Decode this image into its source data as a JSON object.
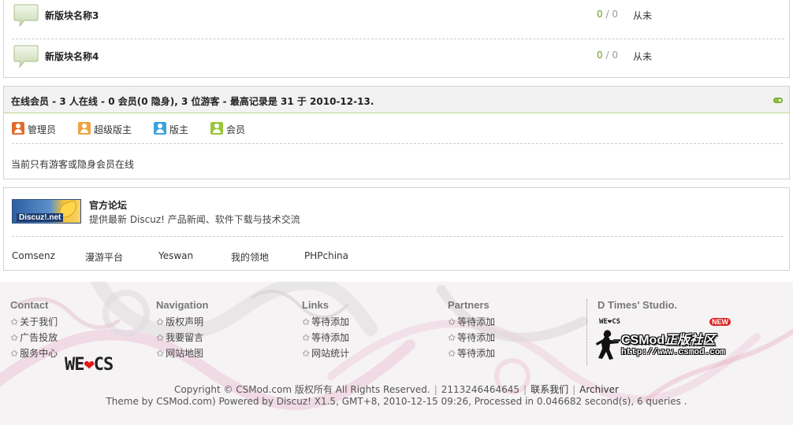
{
  "forums": [
    {
      "name": "新版块名称3",
      "threads": "0",
      "posts": "0",
      "count_sep": " / ",
      "last_post": "从未"
    },
    {
      "name": "新版块名称4",
      "threads": "0",
      "posts": "0",
      "count_sep": " / ",
      "last_post": "从未"
    }
  ],
  "online": {
    "title": "在线会员 - 3 人在线 - 0 会员(0 隐身), 3 位游客 - 最高记录是 31 于 2010-12-13.",
    "legend": [
      {
        "label": "管理员",
        "color": "#e26b2c",
        "icon": "user-admin-icon"
      },
      {
        "label": "超级版主",
        "color": "#f0a340",
        "icon": "user-supermod-icon"
      },
      {
        "label": "版主",
        "color": "#3ea1dc",
        "icon": "user-mod-icon"
      },
      {
        "label": "会员",
        "color": "#9bc53d",
        "icon": "user-member-icon"
      }
    ],
    "status_text": "当前只有游客或隐身会员在线"
  },
  "links": {
    "logo_text": "Discuz!.net",
    "title": "官方论坛",
    "description": "提供最新 Discuz! 产品新闻、软件下载与技术交流",
    "partners": [
      "Comsenz",
      "漫游平台",
      "Yeswan",
      "我的领地",
      "PHPchina"
    ]
  },
  "footer": {
    "columns": [
      {
        "heading": "Contact",
        "items": [
          "关于我们",
          "广告投放",
          "服务中心"
        ]
      },
      {
        "heading": "Navigation",
        "items": [
          "版权声明",
          "我要留言",
          "网站地图"
        ]
      },
      {
        "heading": "Links",
        "items": [
          "等待添加",
          "等待添加",
          "网站统计"
        ]
      },
      {
        "heading": "Partners",
        "items": [
          "等待添加",
          "等待添加",
          "等待添加"
        ]
      }
    ],
    "studio_heading": "D Times' Studio.",
    "we_cs": {
      "left": "WE",
      "right": "CS",
      "heart": "❤"
    },
    "csmod_logo": {
      "small_we": "WE❤CS",
      "new_badge": "NEW",
      "title_en": "CSMod",
      "title_cn": "正版社区",
      "url": "http://www.csmod.com"
    },
    "copyright": "Copyright © CSMod.com 版权所有 All Rights Reserved.",
    "icp": "2113246464645",
    "contact_link": "联系我们",
    "archiver_link": "Archiver",
    "powered": "Theme by CSMod.com) Powered by Discuz! X1.5, GMT+8, 2010-12-15 09:26, Processed in 0.046682 second(s), 6 queries ."
  },
  "colors": {
    "accent_green": "#6a9d18",
    "header_border": "#b9d58d",
    "heart_red": "#e21818"
  }
}
